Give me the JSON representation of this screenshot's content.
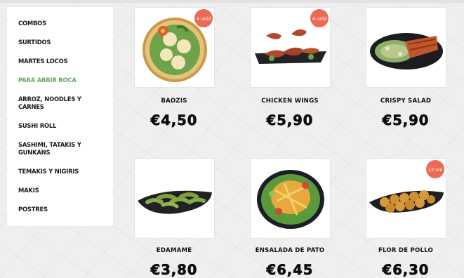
{
  "sidebar": {
    "items": [
      {
        "label": "COMBOS"
      },
      {
        "label": "SURTIDOS"
      },
      {
        "label": "MARTES LOCOS"
      },
      {
        "label": "PARA ABRIR BOCA",
        "active": true
      },
      {
        "label": "ARROZ, NOODLES Y CARNES"
      },
      {
        "label": "SUSHI ROLL"
      },
      {
        "label": "SASHIMI, TATAKIS Y GUNKANS"
      },
      {
        "label": "TEMAKIS Y NIGIRIS"
      },
      {
        "label": "MAKIS"
      },
      {
        "label": "POSTRES"
      }
    ],
    "active_color": "#6fa36b"
  },
  "products": [
    {
      "name": "BAOZIS",
      "price": "€4,50",
      "badge": "4 unid",
      "image": "baozi-basket-image"
    },
    {
      "name": "CHICKEN WINGS",
      "price": "€5,90",
      "badge": "4 unid",
      "image": "chicken-wings-plate-image"
    },
    {
      "name": "CRISPY SALAD",
      "price": "€5,90",
      "badge": "",
      "image": "crispy-salad-plate-image"
    },
    {
      "name": "EDAMAME",
      "price": "€3,80",
      "badge": "",
      "image": "edamame-plate-image"
    },
    {
      "name": "ENSALADA DE PATO",
      "price": "€6,45",
      "badge": "",
      "image": "duck-salad-bowl-image"
    },
    {
      "name": "FLOR DE POLLO",
      "price": "€6,30",
      "badge": "12 uni",
      "image": "chicken-balls-plate-image"
    }
  ],
  "colors": {
    "badge": "#ea6a55",
    "background": "#efefef"
  }
}
